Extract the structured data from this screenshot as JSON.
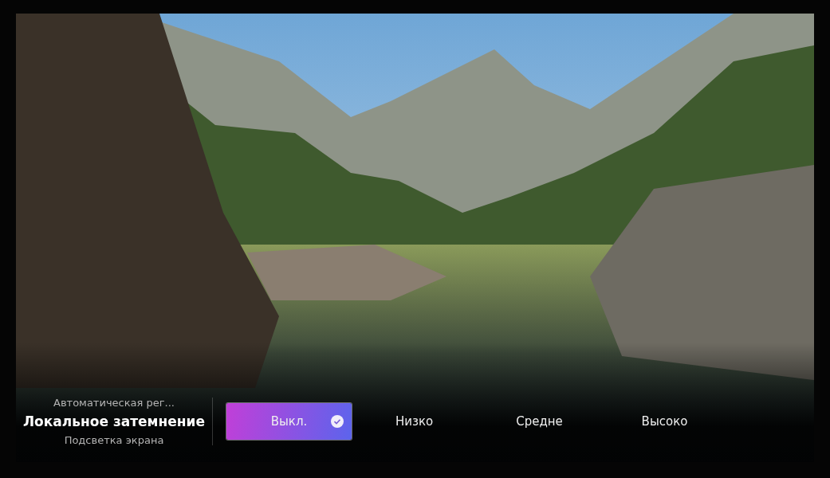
{
  "panel": {
    "parent_setting": "Автоматическая рег...",
    "title": "Локальное затемнение",
    "section": "Подсветка экрана"
  },
  "options": [
    {
      "label": "Выкл.",
      "selected": true
    },
    {
      "label": "Низко",
      "selected": false
    },
    {
      "label": "Средне",
      "selected": false
    },
    {
      "label": "Высоко",
      "selected": false
    }
  ]
}
